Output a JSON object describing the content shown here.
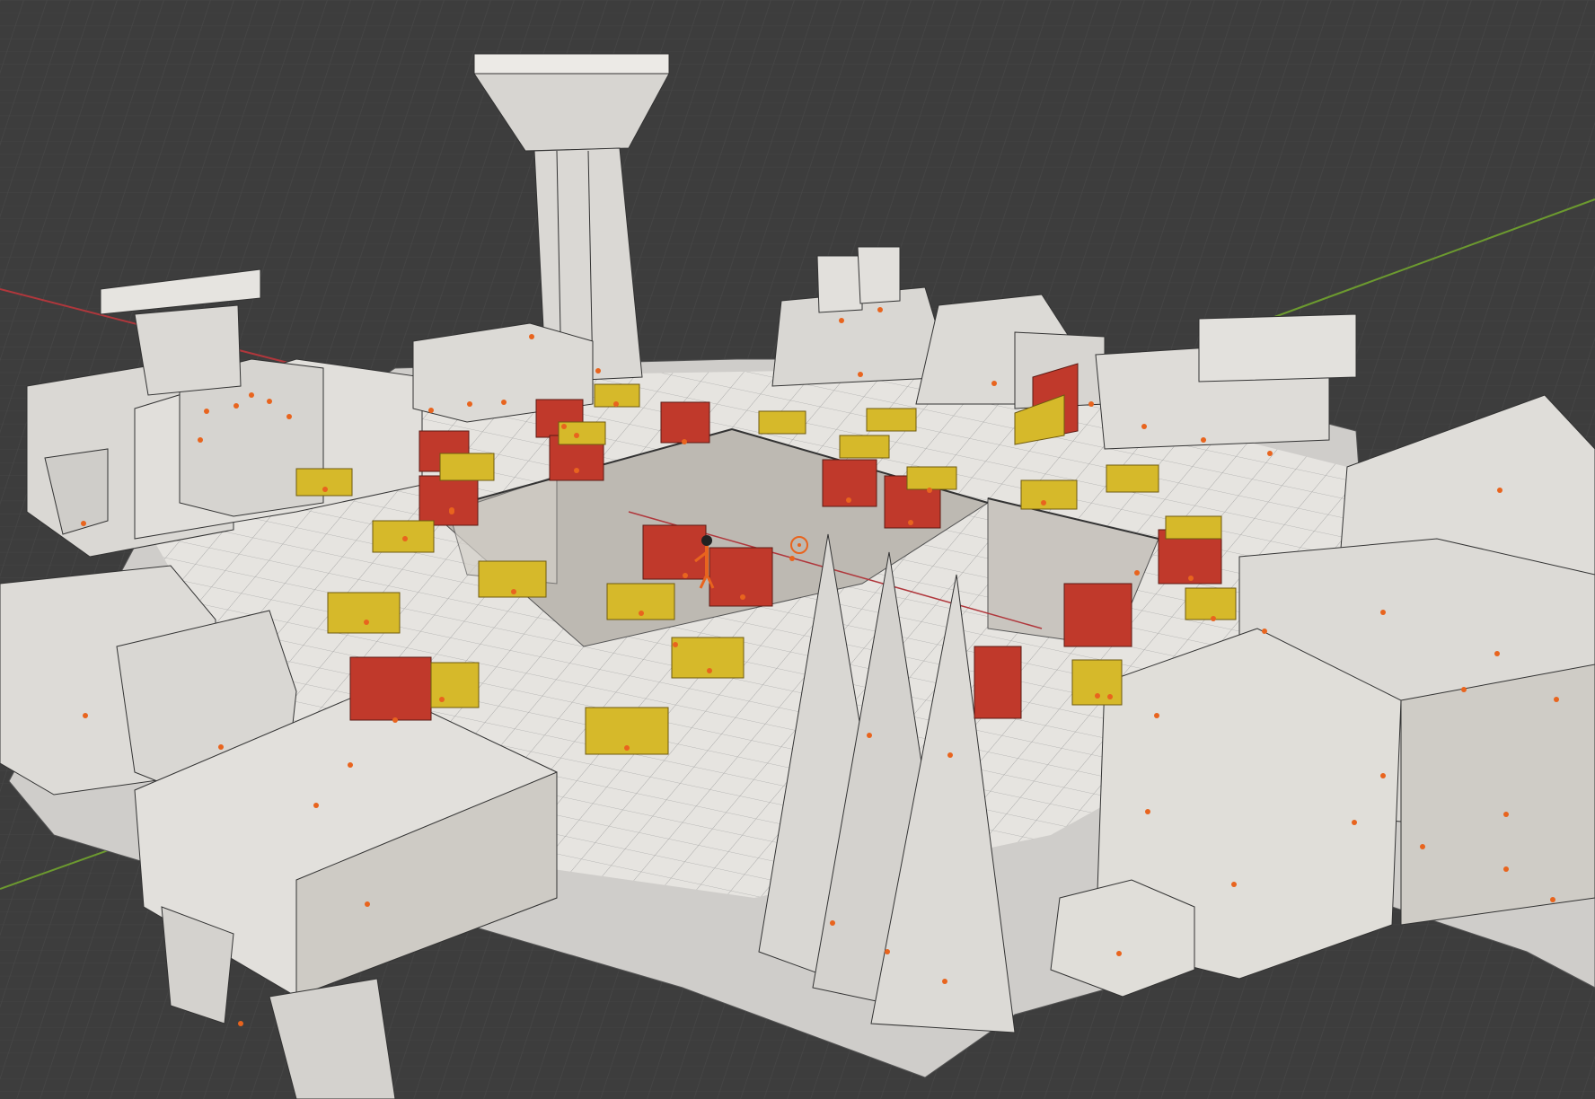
{
  "viewport": {
    "background": "#3d3d3d",
    "grid_line_color": "#4a4a4a",
    "axis_x_color": "#b0373c",
    "axis_y_color": "#6c9a2f",
    "shading": "solid"
  },
  "materials": {
    "default": "#dedcd8",
    "red": "#c0392b",
    "yellow": "#d6b92a",
    "origin_dot": "#e8641e",
    "armature": "#e8641e"
  },
  "objects": {
    "water_tower": "water-tower-mesh",
    "pit": "sunken-pit-mesh",
    "spikes": "spike-cone-meshes",
    "red_crates": "red-crate-meshes",
    "yellow_crates": "yellow-crate-meshes",
    "character": "armature-character",
    "light": "light-object"
  }
}
